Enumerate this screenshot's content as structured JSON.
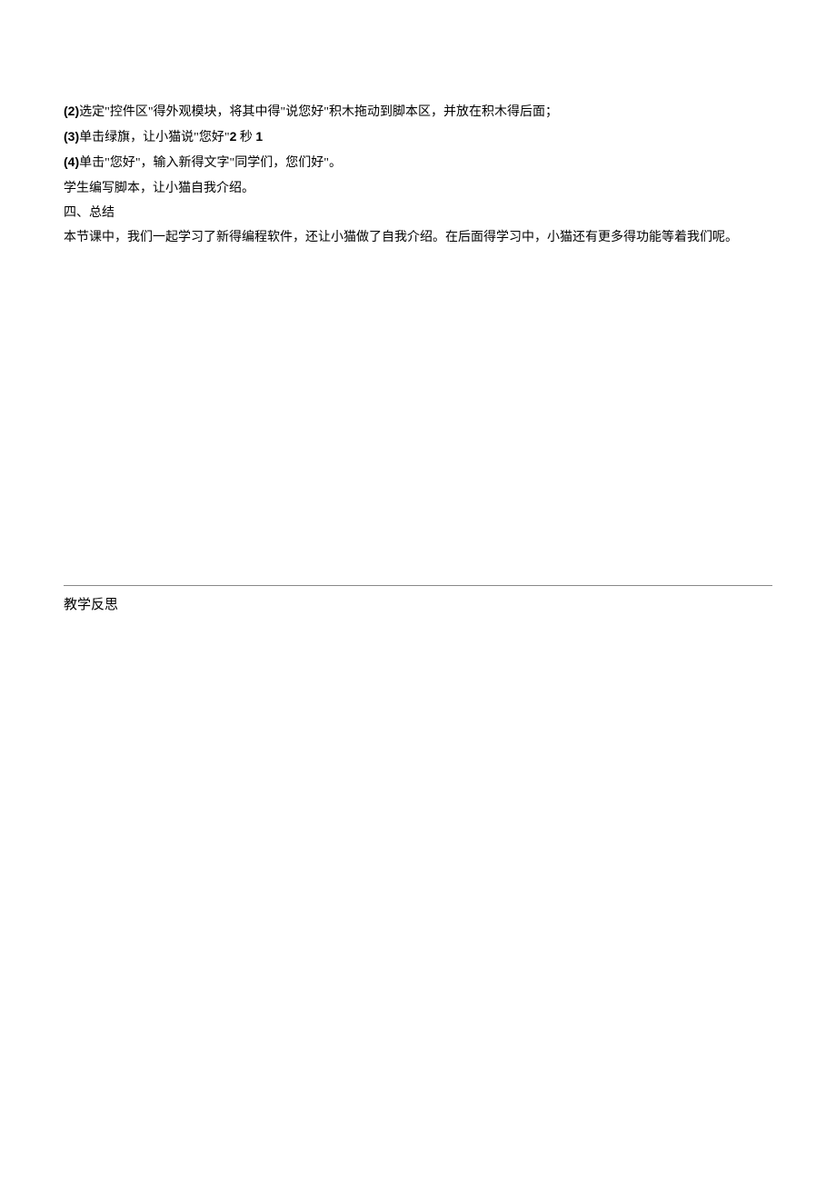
{
  "lines": {
    "line1_prefix": "(2)",
    "line1_text": "选定\"控件区\"得外观模块，将其中得\"说您好\"积木拖动到脚本区，并放在积木得后面；",
    "line2_prefix": "(3)",
    "line2_text_a": "单击绿旗，让小猫说\"您好\"",
    "line2_bold_a": "2",
    "line2_text_b": " 秒 ",
    "line2_bold_b": "1",
    "line3_prefix": "(4)",
    "line3_text": "单击\"您好\"，输入新得文字\"同学们，您们好\"。",
    "line4_text": "学生编写脚本，让小猫自我介绍。",
    "line5_text": "四、总结",
    "line6_text": "本节课中，我们一起学习了新得编程软件，还让小猫做了自我介绍。在后面得学习中，小猫还有更多得功能等着我们呢。"
  },
  "reflection_label": "教学反思"
}
